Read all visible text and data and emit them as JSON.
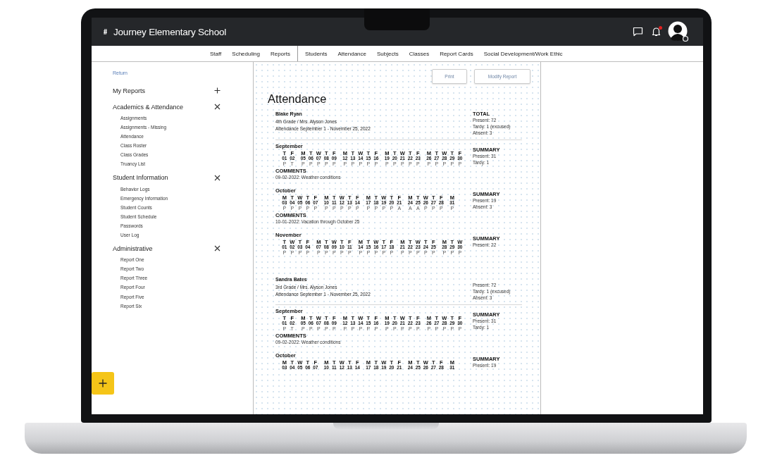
{
  "app": {
    "title": "Journey Elementary School"
  },
  "notifications": {
    "unread": true
  },
  "nav": [
    [
      "Staff",
      "Scheduling",
      "Reports"
    ],
    [
      "Students",
      "Attendance",
      "Subjects",
      "Classes",
      "Report Cards",
      "Social Development/Work Ethic"
    ]
  ],
  "sidebar": {
    "return_link": "Return",
    "sections": [
      {
        "title": "My Reports",
        "expanded": false
      },
      {
        "title": "Academics & Attendance",
        "expanded": true,
        "items": [
          "Assignments",
          "Assignments - Missing",
          "Attendance",
          "Class Roster",
          "Class Grades",
          "Truancy List"
        ]
      },
      {
        "title": "Student Information",
        "expanded": true,
        "items": [
          "Behavior Logs",
          "Emergency Information",
          "Student Counts",
          "Student Schedule",
          "Passwords",
          "User Log"
        ]
      },
      {
        "title": "Administrative",
        "expanded": true,
        "items": [
          "Report One",
          "Report Two",
          "Report Three",
          "Report Four",
          "Report Five",
          "Report Six"
        ]
      }
    ]
  },
  "toolbar": {
    "buttons": [
      "Print",
      "Modify Report"
    ]
  },
  "report": {
    "title": "Attendance",
    "students": [
      {
        "name": "Blake Ryan",
        "class": "4th Grade / Mrs. Alyson Jones",
        "period": "Attendance September 1 - November 25, 2022",
        "totals": {
          "label": "TOTAL",
          "lines": [
            "Present: 72",
            "Tardy: 1 (excused)",
            "Absent: 3"
          ]
        },
        "months": [
          {
            "name": "September",
            "summary": {
              "label": "SUMMARY",
              "lines": [
                "Present: 31",
                "Tardy: 1"
              ]
            },
            "weeks": [
              {
                "weekdays": [
                  "T",
                  "F"
                ],
                "dates": [
                  "01",
                  "02"
                ],
                "marks": [
                  "P",
                  "T"
                ]
              },
              {
                "weekdays": [
                  "M",
                  "T",
                  "W",
                  "T",
                  "F"
                ],
                "dates": [
                  "05",
                  "06",
                  "07",
                  "08",
                  "09"
                ],
                "marks": [
                  "P",
                  "P",
                  "P",
                  "P",
                  "P"
                ]
              },
              {
                "weekdays": [
                  "M",
                  "T",
                  "W",
                  "T",
                  "F"
                ],
                "dates": [
                  "12",
                  "13",
                  "14",
                  "15",
                  "16"
                ],
                "marks": [
                  "P",
                  "P",
                  "P",
                  "P",
                  "P"
                ]
              },
              {
                "weekdays": [
                  "M",
                  "T",
                  "W",
                  "T",
                  "F"
                ],
                "dates": [
                  "19",
                  "20",
                  "21",
                  "22",
                  "23"
                ],
                "marks": [
                  "P",
                  "P",
                  "P",
                  "P",
                  "P"
                ]
              },
              {
                "weekdays": [
                  "M",
                  "T",
                  "W",
                  "T",
                  "F"
                ],
                "dates": [
                  "26",
                  "27",
                  "28",
                  "29",
                  "30"
                ],
                "marks": [
                  "P",
                  "P",
                  "P",
                  "P",
                  "P"
                ]
              }
            ],
            "comments": {
              "label": "COMMENTS",
              "entries": [
                "09-02-2022: Weather conditions"
              ]
            }
          },
          {
            "name": "October",
            "summary": {
              "label": "SUMMARY",
              "lines": [
                "Present: 19",
                "Absent: 3"
              ]
            },
            "weeks": [
              {
                "weekdays": [
                  "M",
                  "T",
                  "W",
                  "T",
                  "F"
                ],
                "dates": [
                  "03",
                  "04",
                  "05",
                  "06",
                  "07"
                ],
                "marks": [
                  "P",
                  "P",
                  "P",
                  "P",
                  "P"
                ]
              },
              {
                "weekdays": [
                  "M",
                  "T",
                  "W",
                  "T",
                  "F"
                ],
                "dates": [
                  "10",
                  "11",
                  "12",
                  "13",
                  "14"
                ],
                "marks": [
                  "P",
                  "P",
                  "P",
                  "P",
                  "P"
                ]
              },
              {
                "weekdays": [
                  "M",
                  "T",
                  "W",
                  "T",
                  "F"
                ],
                "dates": [
                  "17",
                  "18",
                  "19",
                  "20",
                  "21"
                ],
                "marks": [
                  "P",
                  "P",
                  "P",
                  "P",
                  "A"
                ]
              },
              {
                "weekdays": [
                  "M",
                  "T",
                  "W",
                  "T",
                  "F"
                ],
                "dates": [
                  "24",
                  "25",
                  "26",
                  "27",
                  "28"
                ],
                "marks": [
                  "A",
                  "A",
                  "P",
                  "P",
                  "P"
                ]
              },
              {
                "weekdays": [
                  "M"
                ],
                "dates": [
                  "31"
                ],
                "marks": [
                  "P"
                ]
              }
            ],
            "comments": {
              "label": "COMMENTS",
              "entries": [
                "10-01-2022: Vacation through October 25"
              ]
            }
          },
          {
            "name": "November",
            "summary": {
              "label": "SUMMARY",
              "lines": [
                "Present: 22"
              ]
            },
            "weeks": [
              {
                "weekdays": [
                  "T",
                  "W",
                  "T",
                  "F"
                ],
                "dates": [
                  "01",
                  "02",
                  "03",
                  "04"
                ],
                "marks": [
                  "P",
                  "P",
                  "P",
                  "P"
                ]
              },
              {
                "weekdays": [
                  "M",
                  "T",
                  "W",
                  "T",
                  "F"
                ],
                "dates": [
                  "07",
                  "08",
                  "09",
                  "10",
                  "11"
                ],
                "marks": [
                  "P",
                  "P",
                  "P",
                  "P",
                  "P"
                ]
              },
              {
                "weekdays": [
                  "M",
                  "T",
                  "W",
                  "T",
                  "F"
                ],
                "dates": [
                  "14",
                  "15",
                  "16",
                  "17",
                  "18"
                ],
                "marks": [
                  "P",
                  "P",
                  "P",
                  "P",
                  "P"
                ]
              },
              {
                "weekdays": [
                  "M",
                  "T",
                  "W",
                  "T",
                  "F"
                ],
                "dates": [
                  "21",
                  "22",
                  "23",
                  "24",
                  "25"
                ],
                "marks": [
                  "P",
                  "P",
                  "P",
                  "P",
                  "P"
                ]
              },
              {
                "weekdays": [
                  "M",
                  "T",
                  "W"
                ],
                "dates": [
                  "28",
                  "29",
                  "30"
                ],
                "marks": [
                  "P",
                  "P",
                  "P"
                ]
              }
            ]
          }
        ]
      },
      {
        "name": "Sandra Bates",
        "class": "3rd Grade / Mrs. Alyson Jones",
        "period": "Attendance September 1 - November 25, 2022",
        "totals": {
          "lines": [
            "Present: 72",
            "Tardy: 1 (excused)",
            "Absent: 3"
          ]
        },
        "months": [
          {
            "name": "September",
            "summary": {
              "label": "SUMMARY",
              "lines": [
                "Present: 31",
                "Tardy: 1"
              ]
            },
            "weeks": [
              {
                "weekdays": [
                  "T",
                  "F"
                ],
                "dates": [
                  "01",
                  "02"
                ],
                "marks": [
                  "P",
                  "T"
                ]
              },
              {
                "weekdays": [
                  "M",
                  "T",
                  "W",
                  "T",
                  "F"
                ],
                "dates": [
                  "05",
                  "06",
                  "07",
                  "08",
                  "09"
                ],
                "marks": [
                  "P",
                  "P",
                  "P",
                  "P",
                  "P"
                ]
              },
              {
                "weekdays": [
                  "M",
                  "T",
                  "W",
                  "T",
                  "F"
                ],
                "dates": [
                  "12",
                  "13",
                  "14",
                  "15",
                  "16"
                ],
                "marks": [
                  "P",
                  "P",
                  "P",
                  "P",
                  "P"
                ]
              },
              {
                "weekdays": [
                  "M",
                  "T",
                  "W",
                  "T",
                  "F"
                ],
                "dates": [
                  "19",
                  "20",
                  "21",
                  "22",
                  "23"
                ],
                "marks": [
                  "P",
                  "P",
                  "P",
                  "P",
                  "P"
                ]
              },
              {
                "weekdays": [
                  "M",
                  "T",
                  "W",
                  "T",
                  "F"
                ],
                "dates": [
                  "26",
                  "27",
                  "28",
                  "29",
                  "30"
                ],
                "marks": [
                  "P",
                  "P",
                  "P",
                  "P",
                  "P"
                ]
              }
            ],
            "comments": {
              "label": "COMMENTS",
              "entries": [
                "09-02-2022: Weather conditions"
              ]
            }
          },
          {
            "name": "October",
            "summary": {
              "label": "SUMMARY",
              "lines": [
                "Present: 19"
              ]
            },
            "weeks": [
              {
                "weekdays": [
                  "M",
                  "T",
                  "W",
                  "T",
                  "F"
                ],
                "dates": [
                  "03",
                  "04",
                  "05",
                  "06",
                  "07"
                ]
              },
              {
                "weekdays": [
                  "M",
                  "T",
                  "W",
                  "T",
                  "F"
                ],
                "dates": [
                  "10",
                  "11",
                  "12",
                  "13",
                  "14"
                ]
              },
              {
                "weekdays": [
                  "M",
                  "T",
                  "W",
                  "T",
                  "F"
                ],
                "dates": [
                  "17",
                  "18",
                  "19",
                  "20",
                  "21"
                ]
              },
              {
                "weekdays": [
                  "M",
                  "T",
                  "W",
                  "T",
                  "F"
                ],
                "dates": [
                  "24",
                  "25",
                  "26",
                  "27",
                  "28"
                ]
              },
              {
                "weekdays": [
                  "M"
                ],
                "dates": [
                  "31"
                ]
              }
            ]
          }
        ]
      }
    ]
  }
}
